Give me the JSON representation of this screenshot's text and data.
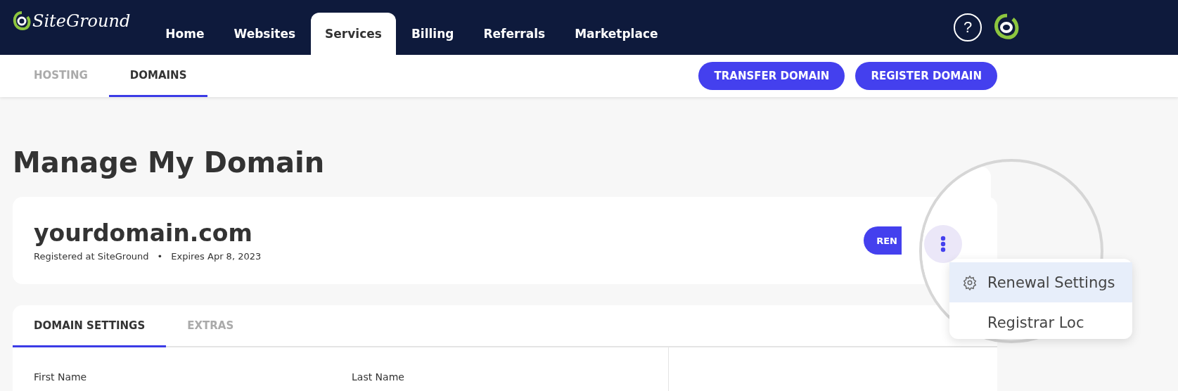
{
  "top_nav": {
    "logo_text": "SiteGround",
    "items": [
      {
        "label": "Home",
        "selected": false
      },
      {
        "label": "Websites",
        "selected": false
      },
      {
        "label": "Services",
        "selected": true
      },
      {
        "label": "Billing",
        "selected": false
      },
      {
        "label": "Referrals",
        "selected": false
      },
      {
        "label": "Marketplace",
        "selected": false
      }
    ],
    "help": "?"
  },
  "sub_nav": {
    "tabs": [
      {
        "label": "HOSTING",
        "selected": false
      },
      {
        "label": "DOMAINS",
        "selected": true
      }
    ],
    "buttons": [
      "TRANSFER DOMAIN",
      "REGISTER DOMAIN"
    ]
  },
  "title": "Manage My Domain",
  "domain_card": {
    "domain": "yourdomain.com",
    "registered": "Registered at SiteGround",
    "separator": "•",
    "expires": "Expires Apr 8, 2023",
    "renew_button": "REN"
  },
  "menu": {
    "items": [
      {
        "label": "Renewal Settings",
        "selected": true
      },
      {
        "label": "Registrar Loc",
        "selected": false
      }
    ]
  },
  "settings_card": {
    "tabs": [
      {
        "label": "DOMAIN SETTINGS",
        "selected": true
      },
      {
        "label": "EXTRAS",
        "selected": false
      }
    ],
    "fields": [
      "First Name",
      "Last Name"
    ]
  }
}
